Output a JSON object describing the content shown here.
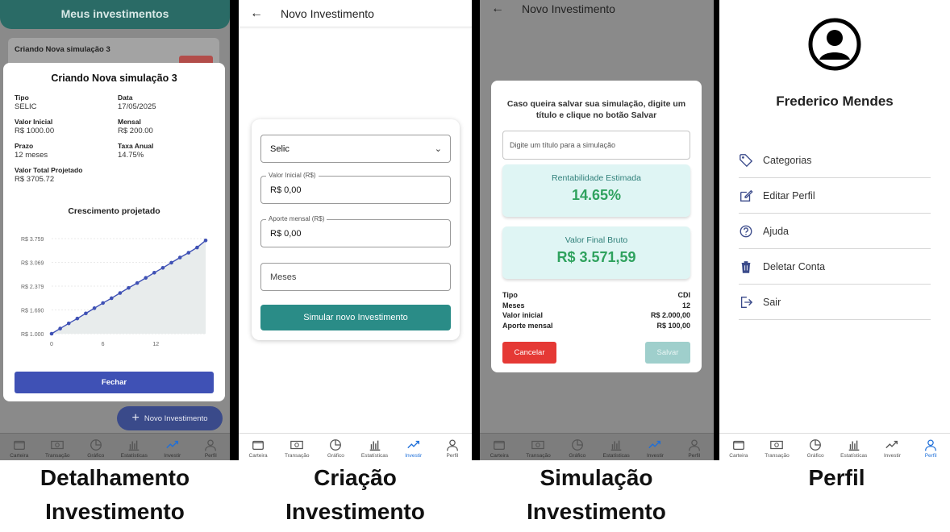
{
  "nav": [
    {
      "label": "Carteira",
      "icon": "wallet-icon"
    },
    {
      "label": "Transação",
      "icon": "money-icon"
    },
    {
      "label": "Gráfico",
      "icon": "pie-chart-icon"
    },
    {
      "label": "Estatísticas",
      "icon": "bar-chart-icon"
    },
    {
      "label": "Investir",
      "icon": "trending-up-icon"
    },
    {
      "label": "Perfil",
      "icon": "person-icon"
    }
  ],
  "screen1": {
    "header_title": "Meus investimentos",
    "behind_card_title": "Criando Nova simulação 3",
    "modal": {
      "title": "Criando Nova simulação 3",
      "fields": [
        {
          "label": "Tipo",
          "value": "SELIC"
        },
        {
          "label": "Data",
          "value": "17/05/2025"
        },
        {
          "label": "Valor Inicial",
          "value": "R$ 1000.00"
        },
        {
          "label": "Mensal",
          "value": "R$ 200.00"
        },
        {
          "label": "Prazo",
          "value": "12 meses"
        },
        {
          "label": "Taxa Anual",
          "value": "14.75%"
        }
      ],
      "total_label": "Valor Total Projetado",
      "total_value": "R$ 3705.72",
      "chart_title": "Crescimento projetado",
      "close_label": "Fechar"
    },
    "fab_label": "Novo Investimento"
  },
  "chart_data": {
    "type": "area",
    "title": "Crescimento projetado",
    "x": [
      0,
      1,
      2,
      3,
      4,
      5,
      6,
      7,
      8,
      9,
      10,
      11,
      12,
      13,
      14,
      15,
      16,
      17,
      18
    ],
    "values": [
      1000,
      1150,
      1300,
      1440,
      1590,
      1740,
      1890,
      2030,
      2180,
      2330,
      2470,
      2620,
      2770,
      2910,
      3060,
      3210,
      3350,
      3500,
      3705
    ],
    "xticks": [
      "0",
      "6",
      "12"
    ],
    "ytick_labels": [
      "R$ 1.000",
      "R$ 1.690",
      "R$ 2.379",
      "R$ 3.069",
      "R$ 3.759"
    ],
    "ylim": [
      1000,
      3759
    ],
    "grid": true,
    "colors": {
      "line": "#3f51b5",
      "fill": "#e8ecec"
    }
  },
  "screen2": {
    "title": "Novo Investimento",
    "select_value": "Selic",
    "initial_label": "Valor Inicial (R$)",
    "initial_value": "R$ 0,00",
    "monthly_label": "Aporte mensal (R$)",
    "monthly_value": "R$ 0,00",
    "months_placeholder": "Meses",
    "button_label": "Simular novo Investimento"
  },
  "screen3": {
    "title": "Novo Investimento",
    "message": "Caso queira salvar sua simulação, digite um título e clique no botão Salvar",
    "input_placeholder": "Digite um título para a simulação",
    "rent_label": "Rentabilidade Estimada",
    "rent_value": "14.65%",
    "final_label": "Valor Final Bruto",
    "final_value": "R$ 3.571,59",
    "summary": [
      {
        "label": "Tipo",
        "value": "CDI"
      },
      {
        "label": "Meses",
        "value": "12"
      },
      {
        "label": "Valor inicial",
        "value": "R$ 2.000,00"
      },
      {
        "label": "Aporte mensal",
        "value": "R$ 100,00"
      }
    ],
    "cancel_label": "Cancelar",
    "save_label": "Salvar"
  },
  "screen4": {
    "name": "Frederico Mendes",
    "menu": [
      {
        "label": "Categorias",
        "icon": "tag-icon"
      },
      {
        "label": "Editar Perfil",
        "icon": "edit-icon"
      },
      {
        "label": "Ajuda",
        "icon": "help-icon"
      },
      {
        "label": "Deletar Conta",
        "icon": "trash-icon"
      },
      {
        "label": "Sair",
        "icon": "logout-icon"
      }
    ]
  },
  "captions": {
    "c1": "Detalhamento Investimento",
    "c2": "Criação Investimento",
    "c3": "Simulação Investimento",
    "c4": "Perfil"
  },
  "colors": {
    "teal": "#2a8c87",
    "indigo": "#3f51b5",
    "red": "#e53935",
    "green": "#2fa25e"
  }
}
